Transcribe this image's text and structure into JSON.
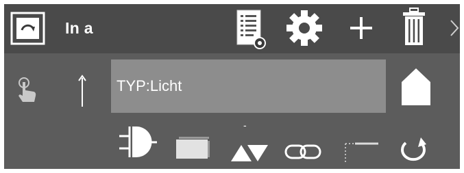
{
  "toolbar": {
    "title": "In a",
    "icons": [
      "toggle-icon",
      "document-list-icon",
      "gear-icon",
      "plus-icon",
      "trash-icon",
      "chevron-right-icon"
    ]
  },
  "main": {
    "type_field": "TYP:Licht",
    "left_icons": [
      "hand-pointer-icon",
      "arrow-up-icon"
    ],
    "right_icons": [
      "home-icon"
    ]
  },
  "palette": {
    "dash_label": "-",
    "icons": [
      "and-gate-icon",
      "card-icon",
      "triangles-icon",
      "link-icon",
      "dotted-connector-icon",
      "refresh-icon"
    ]
  },
  "colors": {
    "panel": "#5c5c5c",
    "toolbar": "#4a4a4a",
    "field": "#8d8d8d",
    "icon": "#ffffff"
  }
}
